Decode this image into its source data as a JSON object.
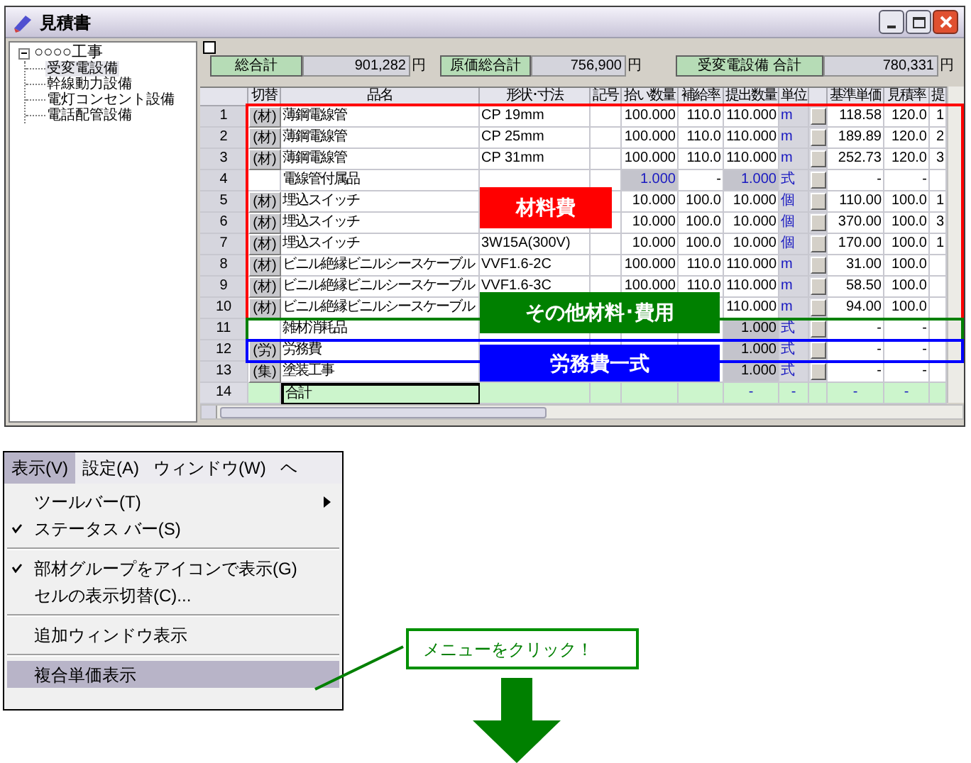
{
  "window": {
    "title": "見積書"
  },
  "tree": {
    "label": "○○○○工事",
    "expanded": true,
    "children": [
      {
        "label": "受変電設備",
        "selected": true
      },
      {
        "label": "幹線動力設備",
        "selected": false
      },
      {
        "label": "電灯コンセント設備",
        "selected": false
      },
      {
        "label": "電話配管設備",
        "selected": false
      }
    ]
  },
  "summary": [
    {
      "label": "総合計",
      "value": "901,282",
      "unit": "円"
    },
    {
      "label": "原価総合計",
      "value": "756,900",
      "unit": "円"
    },
    {
      "label": "受変電設備 合計",
      "value": "780,331",
      "unit": "円"
    }
  ],
  "select_all": {
    "checked": false
  },
  "grid": {
    "columns": [
      "切替",
      "品名",
      "形状･寸法",
      "記号",
      "拾い数量",
      "補給率",
      "提出数量",
      "単位",
      "基準単価",
      "見積率",
      "提"
    ],
    "rows": [
      {
        "no": "1",
        "kind": "item",
        "switch": "(材)",
        "name": "薄鋼電線管",
        "size": "CP 19mm",
        "qty": "100.000",
        "rate": "110.0",
        "out": "110.000",
        "unit": "m",
        "base": "118.58",
        "est": "120.0",
        "col_12": "1"
      },
      {
        "no": "2",
        "kind": "item",
        "switch": "(材)",
        "name": "薄鋼電線管",
        "size": "CP 25mm",
        "qty": "100.000",
        "rate": "110.0",
        "out": "110.000",
        "unit": "m",
        "base": "189.89",
        "est": "120.0",
        "col_12": "2"
      },
      {
        "no": "3",
        "kind": "item",
        "switch": "(材)",
        "name": "薄鋼電線管",
        "size": "CP 31mm",
        "qty": "100.000",
        "rate": "110.0",
        "out": "110.000",
        "unit": "m",
        "base": "252.73",
        "est": "120.0",
        "col_12": "3"
      },
      {
        "no": "4",
        "kind": "group",
        "name": "電線管付属品",
        "qty": "1.000",
        "rate": "-",
        "out": "1.000",
        "unit": "式",
        "base": "-",
        "est": "-"
      },
      {
        "no": "5",
        "kind": "item",
        "switch": "(材)",
        "name": "埋込スイッチ",
        "qty": "10.000",
        "rate": "100.0",
        "out": "10.000",
        "unit": "個",
        "base": "110.00",
        "est": "100.0",
        "col_12": "1"
      },
      {
        "no": "6",
        "kind": "item",
        "switch": "(材)",
        "name": "埋込スイッチ",
        "qty": "10.000",
        "rate": "100.0",
        "out": "10.000",
        "unit": "個",
        "base": "370.00",
        "est": "100.0",
        "col_12": "3"
      },
      {
        "no": "7",
        "kind": "item",
        "switch": "(材)",
        "name": "埋込スイッチ",
        "size": "3W15A(300V)",
        "qty": "10.000",
        "rate": "100.0",
        "out": "10.000",
        "unit": "個",
        "base": "170.00",
        "est": "100.0",
        "col_12": "1"
      },
      {
        "no": "8",
        "kind": "item",
        "switch": "(材)",
        "name": "ビニル絶縁ビニルシースケーブル",
        "size": "VVF1.6-2C",
        "qty": "100.000",
        "rate": "110.0",
        "out": "110.000",
        "unit": "m",
        "base": "31.00",
        "est": "100.0"
      },
      {
        "no": "9",
        "kind": "item",
        "switch": "(材)",
        "name": "ビニル絶縁ビニルシースケーブル",
        "size": "VVF1.6-3C",
        "qty": "100.000",
        "rate": "110.0",
        "out": "110.000",
        "unit": "m",
        "base": "58.50",
        "est": "100.0"
      },
      {
        "no": "10",
        "kind": "item",
        "switch": "(材)",
        "name": "ビニル絶縁ビニルシースケーブル",
        "out": "110.000",
        "unit": "m",
        "base": "94.00",
        "est": "100.0"
      },
      {
        "no": "11",
        "kind": "lump",
        "name": "雑材消耗品",
        "out": "1.000",
        "unit": "式",
        "base": "-",
        "est": "-"
      },
      {
        "no": "12",
        "kind": "lump",
        "switch": "(労)",
        "name": "労務費",
        "out": "1.000",
        "unit": "式",
        "base": "-",
        "est": "-"
      },
      {
        "no": "13",
        "kind": "lump",
        "switch": "(集)",
        "name": "塗装工事",
        "out": "1.000",
        "unit": "式",
        "base": "-",
        "est": "-"
      },
      {
        "no": "14",
        "kind": "total",
        "name": "合計",
        "out": "-",
        "unit": "-",
        "base": "-",
        "est": "-"
      }
    ]
  },
  "callouts": [
    {
      "label": "材料費",
      "color": "#ff0000"
    },
    {
      "label": "その他材料･費用",
      "color": "#008000"
    },
    {
      "label": "労務費一式",
      "color": "#0000ff"
    }
  ],
  "menu_bar": [
    {
      "label": "表示(V)",
      "selected": true
    },
    {
      "label": "設定(A)",
      "selected": false
    },
    {
      "label": "ウィンドウ(W)",
      "selected": false
    },
    {
      "label": "ヘ",
      "selected": false
    }
  ],
  "menu_items": [
    {
      "kind": "submenu",
      "label": "ツールバー(T)",
      "checked": false,
      "selected": false
    },
    {
      "kind": "item",
      "label": "ステータス バー(S)",
      "checked": true,
      "selected": false
    },
    {
      "kind": "separator"
    },
    {
      "kind": "item",
      "label": "部材グループをアイコンで表示(G)",
      "checked": true,
      "selected": false
    },
    {
      "kind": "item",
      "label": "セルの表示切替(C)...",
      "checked": false,
      "selected": false
    },
    {
      "kind": "separator"
    },
    {
      "kind": "item",
      "label": "追加ウィンドウ表示",
      "checked": false,
      "selected": false
    },
    {
      "kind": "separator"
    },
    {
      "kind": "item",
      "label": "複合単価表示",
      "checked": false,
      "selected": true
    }
  ],
  "callout_note": {
    "text": "メニューをクリック！"
  }
}
